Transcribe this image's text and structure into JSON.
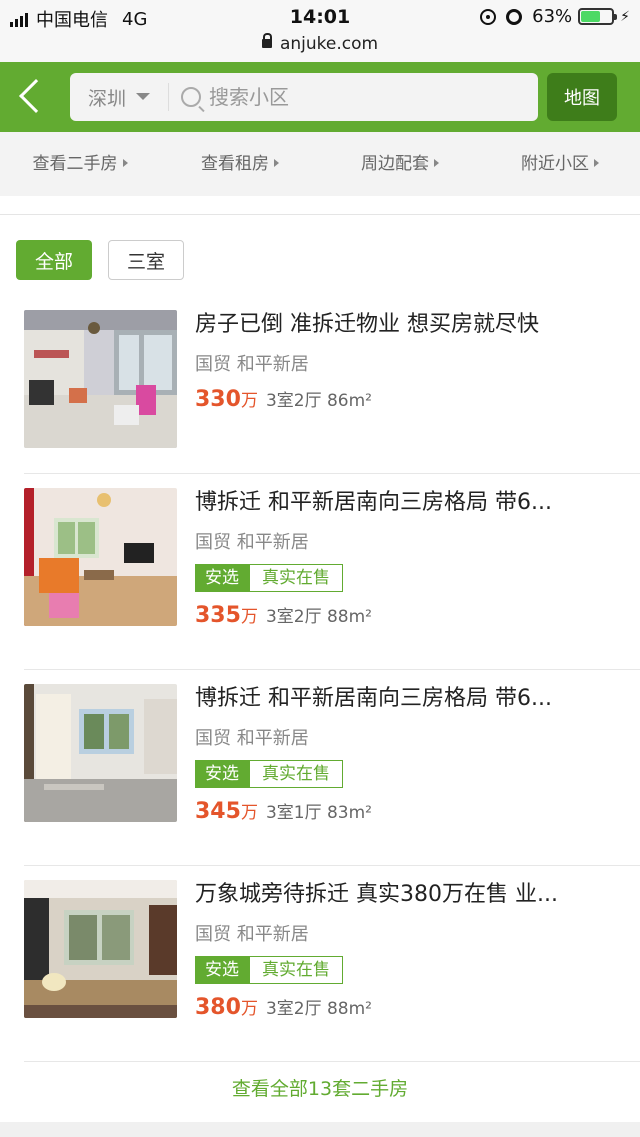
{
  "status_bar": {
    "carrier": "中国电信",
    "network": "4G",
    "time": "14:01",
    "battery": "63%",
    "battery_level": 0.63
  },
  "url_bar": {
    "url": "anjuke.com"
  },
  "header": {
    "city": "深圳",
    "search_placeholder": "搜索小区",
    "map_label": "地图",
    "brand_color": "#62ab31"
  },
  "subnav": {
    "items": [
      {
        "label": "查看二手房"
      },
      {
        "label": "查看租房"
      },
      {
        "label": "周边配套"
      },
      {
        "label": "附近小区"
      }
    ]
  },
  "filters": {
    "all": "全部",
    "three_room": "三室"
  },
  "listings": [
    {
      "title": "房子已倒 准拆迁物业 想买房就尽快",
      "location": "国贸 和平新居",
      "price": "330",
      "unit": "万",
      "specs": "3室2厅 86m²",
      "tags": []
    },
    {
      "title": "博拆迁 和平新居南向三房格局 带6...",
      "location": "国贸 和平新居",
      "price": "335",
      "unit": "万",
      "specs": "3室2厅 88m²",
      "tags": [
        "安选",
        "真实在售"
      ]
    },
    {
      "title": "博拆迁 和平新居南向三房格局 带6...",
      "location": "国贸 和平新居",
      "price": "345",
      "unit": "万",
      "specs": "3室1厅 83m²",
      "tags": [
        "安选",
        "真实在售"
      ]
    },
    {
      "title": "万象城旁待拆迁 真实380万在售 业...",
      "location": "国贸 和平新居",
      "price": "380",
      "unit": "万",
      "specs": "3室2厅 88m²",
      "tags": [
        "安选",
        "真实在售"
      ]
    }
  ],
  "footer": {
    "view_all": "查看全部13套二手房"
  }
}
